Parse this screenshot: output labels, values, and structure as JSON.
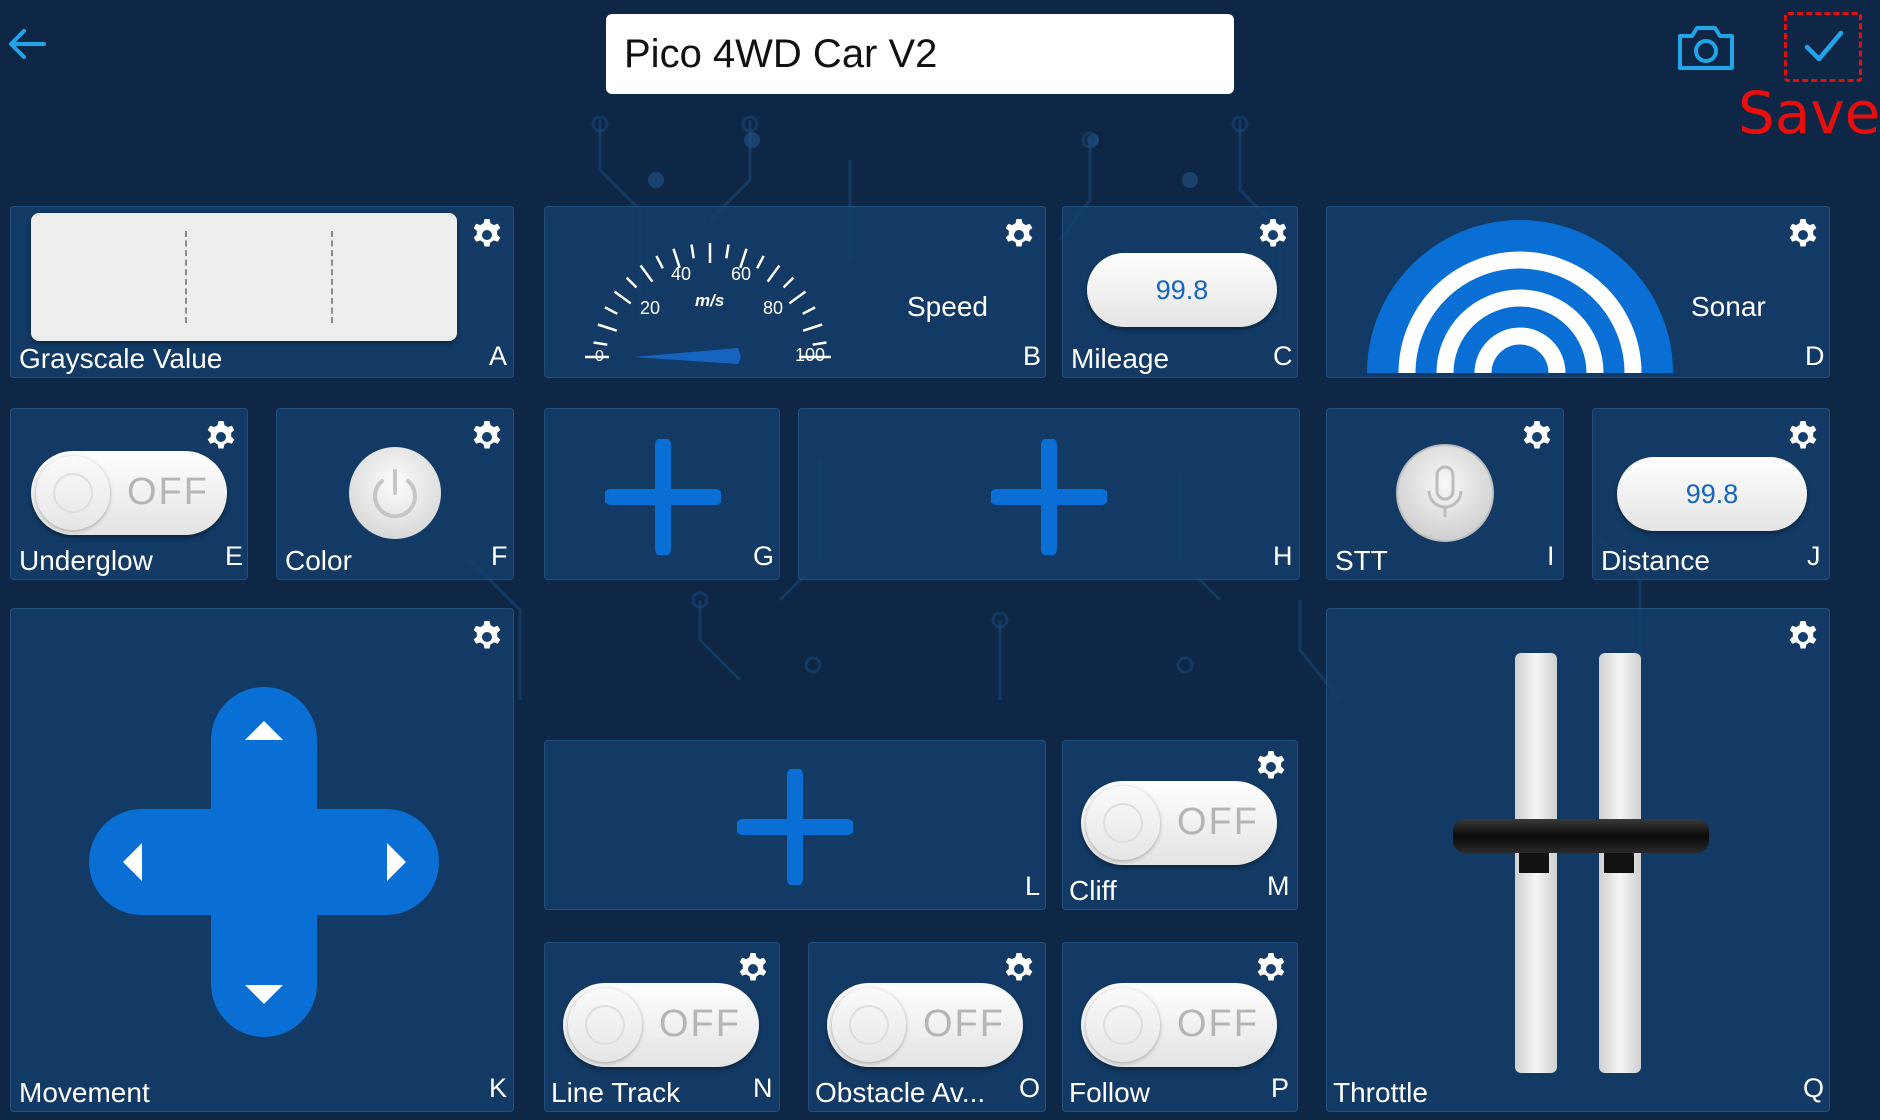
{
  "header": {
    "title_value": "Pico 4WD Car V2",
    "save_label": "Save",
    "back_icon": "arrow-left-icon",
    "camera_icon": "camera-icon",
    "save_icon": "checkmark-icon"
  },
  "colors": {
    "background": "#0f2746",
    "panel": "#13406e",
    "accent_blue": "#0a6fd4",
    "header_icon": "#21a4e8",
    "save_red": "#e01010"
  },
  "panels": {
    "A": {
      "label": "Grayscale Value",
      "letter": "A"
    },
    "B": {
      "label": "Speed",
      "letter": "B",
      "unit": "m/s",
      "ticks": [
        "0",
        "20",
        "40",
        "60",
        "80",
        "100"
      ]
    },
    "C": {
      "label": "Mileage",
      "letter": "C",
      "value": "99.8"
    },
    "D": {
      "label": "Sonar",
      "letter": "D"
    },
    "E": {
      "label": "Underglow",
      "letter": "E",
      "state": "OFF"
    },
    "F": {
      "label": "Color",
      "letter": "F"
    },
    "G": {
      "label": "",
      "letter": "G"
    },
    "H": {
      "label": "",
      "letter": "H"
    },
    "I": {
      "label": "STT",
      "letter": "I"
    },
    "J": {
      "label": "Distance",
      "letter": "J",
      "value": "99.8"
    },
    "K": {
      "label": "Movement",
      "letter": "K"
    },
    "L": {
      "label": "",
      "letter": "L"
    },
    "M": {
      "label": "Cliff",
      "letter": "M",
      "state": "OFF"
    },
    "N": {
      "label": "Line Track",
      "letter": "N",
      "state": "OFF"
    },
    "O": {
      "label": "Obstacle Av...",
      "letter": "O",
      "state": "OFF"
    },
    "P": {
      "label": "Follow",
      "letter": "P",
      "state": "OFF"
    },
    "Q": {
      "label": "Throttle",
      "letter": "Q"
    }
  }
}
